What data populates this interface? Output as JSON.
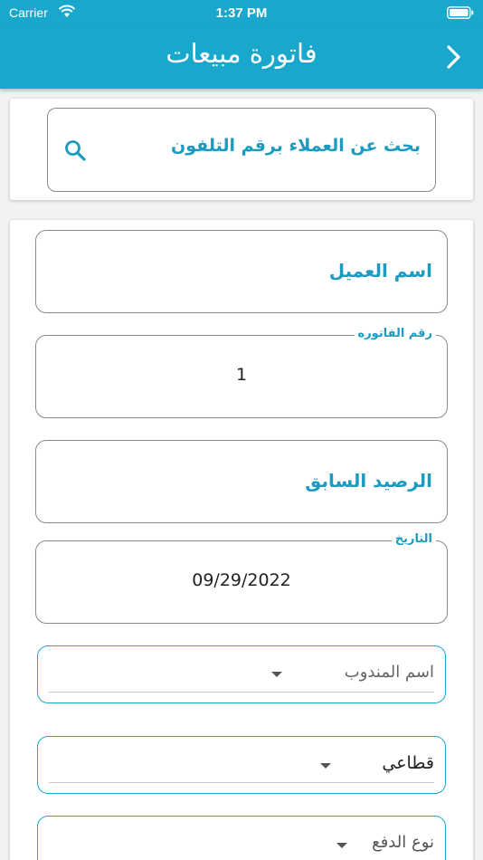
{
  "status_bar": {
    "carrier": "Carrier",
    "time": "1:37 PM"
  },
  "app_bar": {
    "title": "فاتورة مبيعات",
    "back_icon": "chevron-right-icon"
  },
  "search": {
    "placeholder": "بحث عن العملاء برقم التلفون",
    "icon": "search-icon"
  },
  "form": {
    "customer_name": {
      "placeholder": "اسم العميل"
    },
    "invoice_number": {
      "label": "رقم الفاتوره",
      "value": "1"
    },
    "previous_balance": {
      "placeholder": "الرصيد السابق"
    },
    "date": {
      "label": "التاريخ",
      "value": "09/29/2022"
    },
    "representative": {
      "placeholder": "اسم المندوب"
    },
    "sale_type": {
      "selected": "قطاعي"
    },
    "payment_type": {
      "placeholder": "نوع الدفع"
    }
  },
  "colors": {
    "primary": "#1aa7cc",
    "accent_text": "#1a9bbf"
  }
}
